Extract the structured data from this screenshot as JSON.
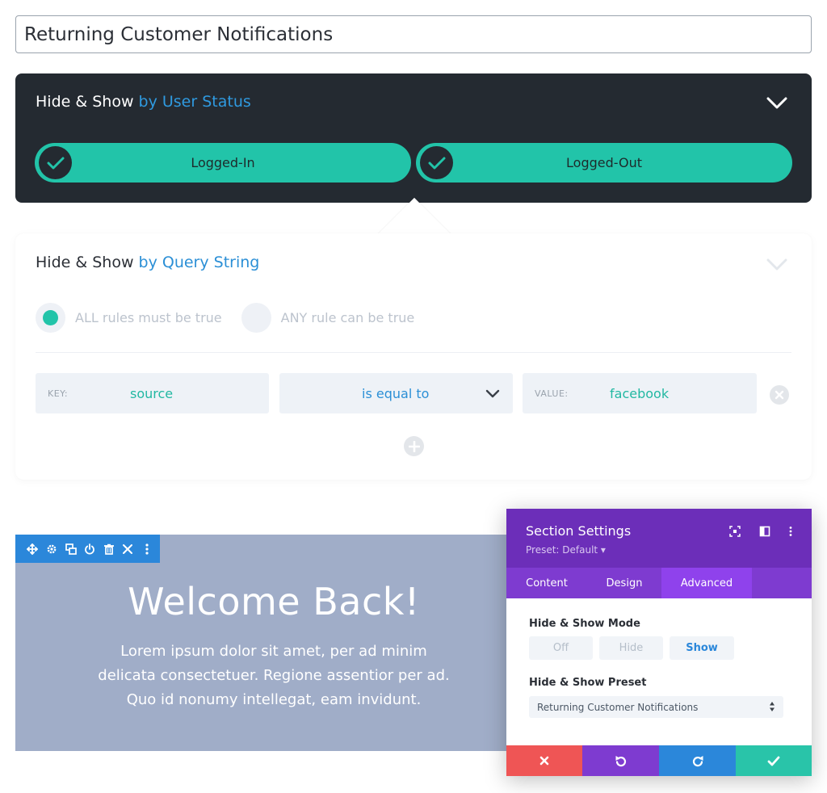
{
  "title_input": {
    "value": "Returning Customer Notifications"
  },
  "user_status": {
    "heading_prefix": "Hide & Show",
    "heading_accent": "by User Status",
    "options": [
      {
        "label": "Logged-In",
        "checked": true
      },
      {
        "label": "Logged-Out",
        "checked": true
      }
    ],
    "toggle_color": "#22c4a9"
  },
  "query_string": {
    "heading_prefix": "Hide & Show",
    "heading_accent": "by Query String",
    "radio_all_label": "ALL rules must be true",
    "radio_any_label": "ANY rule can be true",
    "selected_radio": "all",
    "rule": {
      "key_label": "KEY:",
      "key_value": "source",
      "operator": "is equal to",
      "value_label": "VALUE:",
      "value_value": "facebook"
    }
  },
  "preview": {
    "heading": "Welcome Back!",
    "body_lines": [
      "Lorem ipsum dolor sit amet, per ad minim",
      "delicata consectetuer. Regione assentior per ad.",
      "Quo id nonumy intellegat, eam invidunt."
    ],
    "toolbar_icons": [
      "move-icon",
      "gear-icon",
      "duplicate-icon",
      "power-icon",
      "trash-icon",
      "close-icon",
      "more-icon"
    ]
  },
  "settings_modal": {
    "title": "Section Settings",
    "preset_label": "Preset: Default ▾",
    "tabs": [
      {
        "label": "Content",
        "active": false
      },
      {
        "label": "Design",
        "active": false
      },
      {
        "label": "Advanced",
        "active": true
      }
    ],
    "mode_title": "Hide & Show Mode",
    "mode_options": [
      {
        "label": "Off",
        "selected": false
      },
      {
        "label": "Hide",
        "selected": false
      },
      {
        "label": "Show",
        "selected": true
      }
    ],
    "preset_title": "Hide & Show Preset",
    "preset_value": "Returning Customer Notifications",
    "footer_colors": {
      "cancel": "#ef5555",
      "undo": "#7e3bd0",
      "redo": "#2b87da",
      "save": "#29c4a9"
    }
  }
}
